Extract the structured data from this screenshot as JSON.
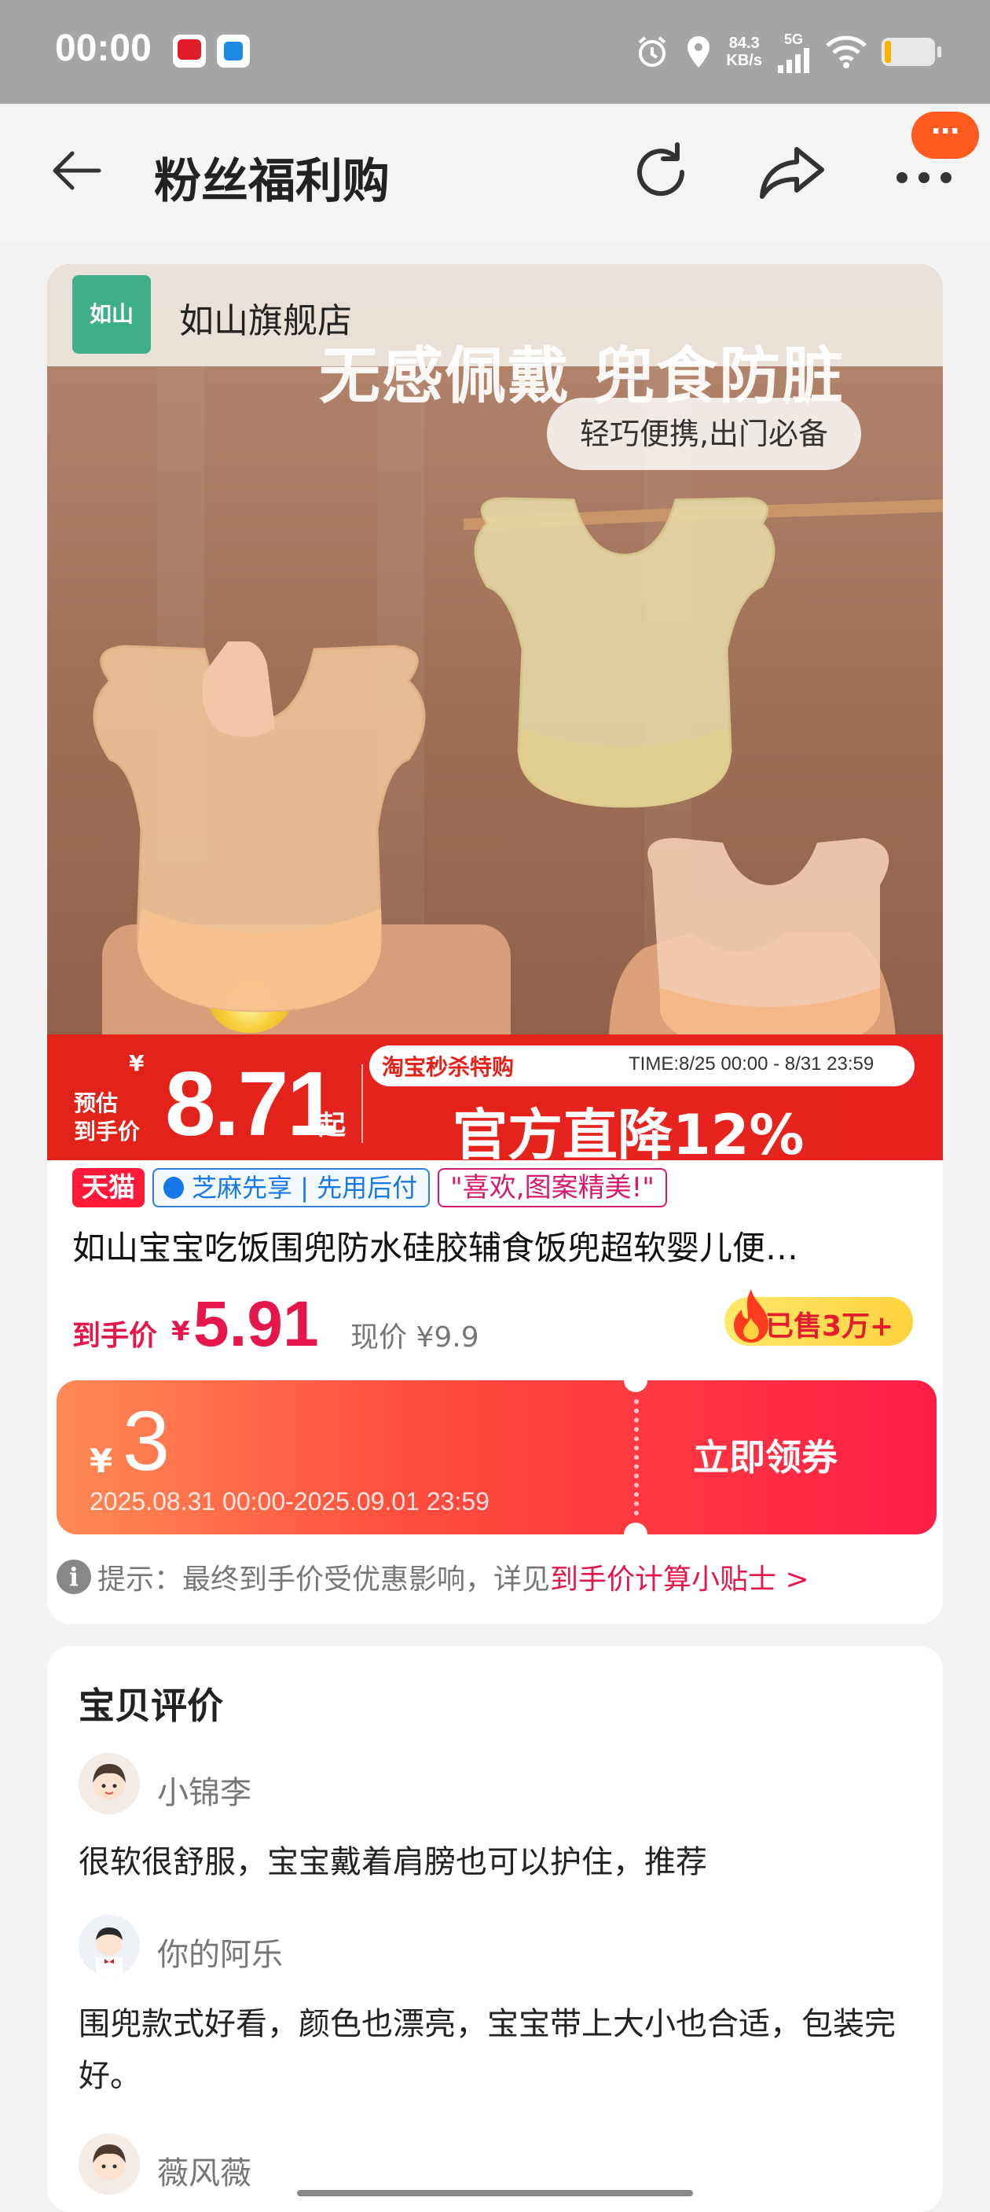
{
  "status_bar": {
    "time": "00:00",
    "net_speed_value": "84.3",
    "net_speed_unit": "KB/s",
    "signal": "5G",
    "icons": [
      "taobao-live-icon",
      "app-icon",
      "alarm-icon",
      "location-icon",
      "signal-icon",
      "wifi-icon",
      "battery-icon"
    ]
  },
  "nav": {
    "title": "粉丝福利购",
    "badge": "⋯",
    "icons": [
      "back-arrow-icon",
      "refresh-icon",
      "share-icon",
      "more-icon"
    ]
  },
  "product": {
    "store_name": "如山旗舰店",
    "store_logo_text": "如山",
    "hero_headline": "无感佩戴 兜食防脏",
    "hero_pill": "轻巧便携,出门必备",
    "promo": {
      "yen": "¥",
      "estimate_label_line1": "预估",
      "estimate_label_line2": "到手价",
      "price": "8.71",
      "suffix": "起",
      "tag": "淘宝秒杀特购",
      "time_range": "TIME:8/25 00:00 - 8/31 23:59",
      "headline": "官方直降12%"
    },
    "badges": {
      "tmall": "天猫",
      "zhima": "芝麻先享 | 先用后付",
      "review": "\"喜欢,图案精美!\""
    },
    "title": "如山宝宝吃饭围兜防水硅胶辅食饭兜超软婴儿便…",
    "price_label": "到手价",
    "price_yen": "¥",
    "price_value": "5.91",
    "original_price": "现价 ¥9.9",
    "sold": "已售3万+",
    "coupon": {
      "yen": "¥",
      "amount": "3",
      "validity": "2025.08.31 00:00-2025.09.01 23:59",
      "button": "立即领券"
    },
    "tip_prefix": "提示：最终到手价受优惠影响，详见",
    "tip_link": "到手价计算小贴士 >"
  },
  "reviews": {
    "title": "宝贝评价",
    "items": [
      {
        "name": "小锦李",
        "text": "很软很舒服，宝宝戴着肩膀也可以护住，推荐"
      },
      {
        "name": "你的阿乐",
        "text": "围兜款式好看，颜色也漂亮，宝宝带上大小也合适，包装完好。"
      },
      {
        "name": "薇风薇",
        "text": ""
      }
    ]
  },
  "colors": {
    "accent_red": "#e5174a",
    "promo_red": "#e2231a",
    "coupon_start": "#ff8a55",
    "coupon_end": "#ff1e46",
    "tmall_red": "#ff1a3a",
    "zhima_blue": "#1677e6"
  }
}
